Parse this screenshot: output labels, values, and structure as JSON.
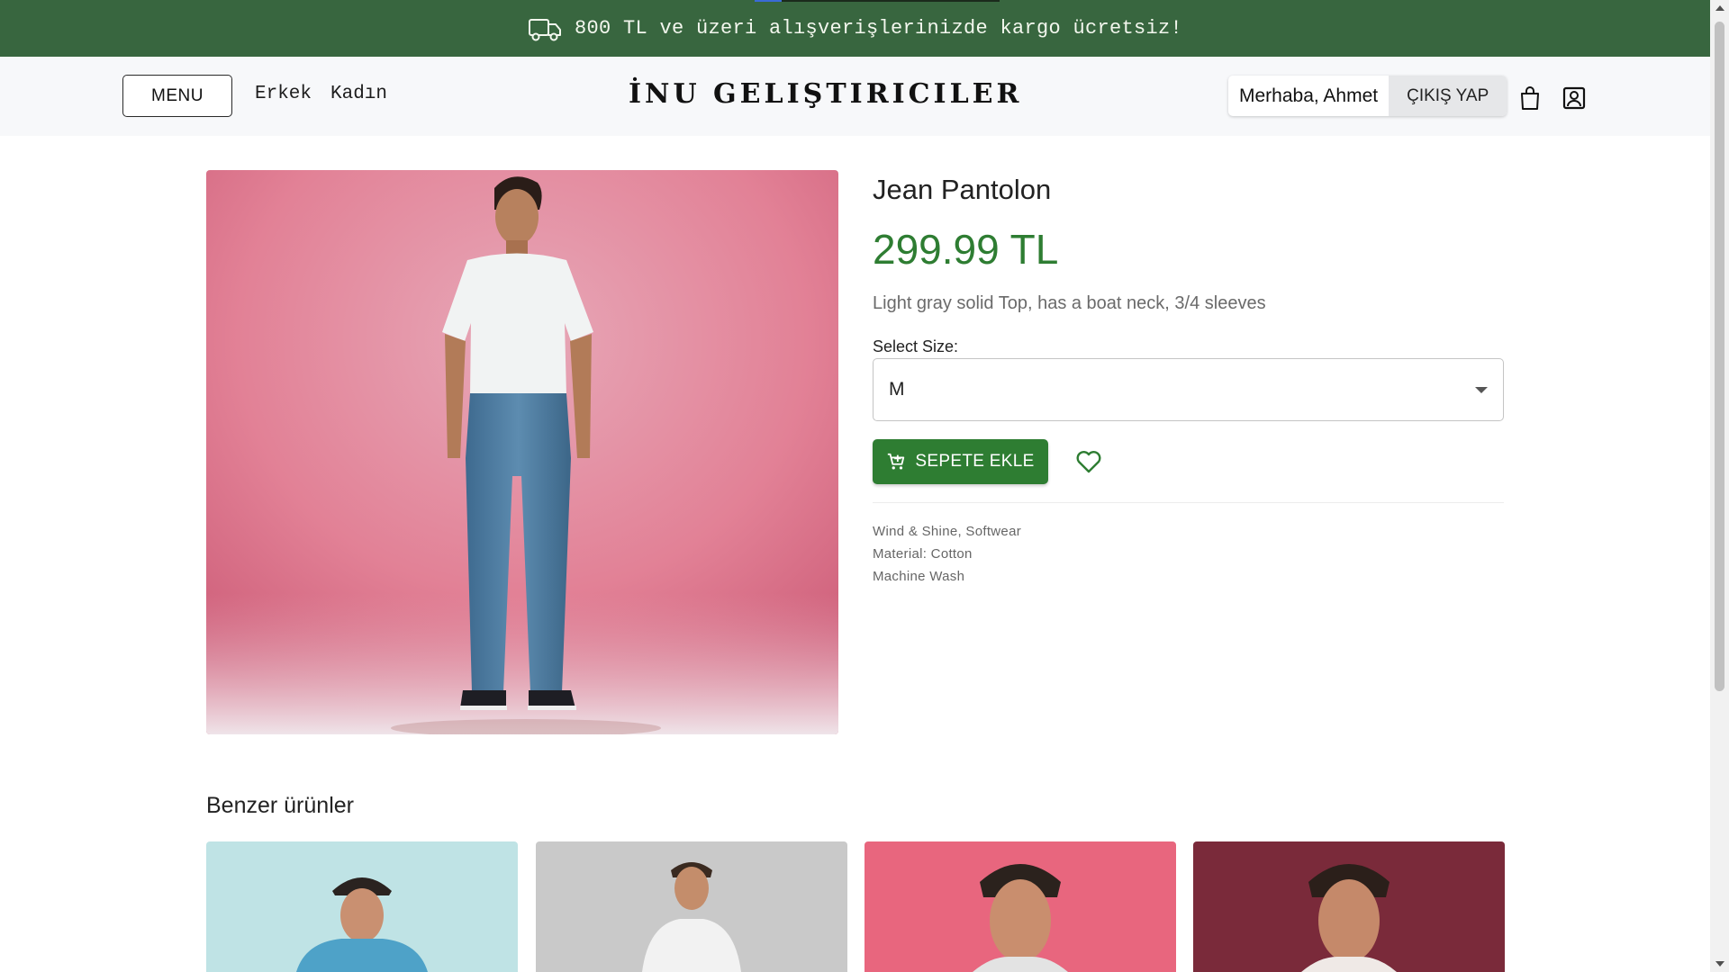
{
  "promo": {
    "text": "800 TL ve üzeri alışverişlerinizde kargo ücretsiz!",
    "icon": "truck-icon",
    "bg_color": "#38663f"
  },
  "header": {
    "menu_label": "MENU",
    "nav": [
      "Erkek",
      "Kadın"
    ],
    "brand": "İNU GELIŞTIRICILER",
    "greeting": "Merhaba, Ahmet",
    "logout_label": "ÇIKIŞ YAP",
    "icons": [
      "shopping-bag-icon",
      "user-profile-icon"
    ]
  },
  "product": {
    "title": "Jean Pantolon",
    "price": "299.99 TL",
    "description": "Light gray solid Top, has a boat neck, 3/4 sleeves",
    "size_label": "Select Size:",
    "selected_size": "M",
    "add_to_cart_label": "SEPETE EKLE",
    "meta": [
      "Wind & Shine, Softwear",
      "Material: Cotton",
      "Machine Wash"
    ],
    "price_color": "#2e7d32"
  },
  "similar": {
    "heading": "Benzer ürünler",
    "cards": [
      {
        "bg": "#bfe3e5"
      },
      {
        "bg": "#c9c9c9"
      },
      {
        "bg": "#e8667e"
      },
      {
        "bg": "#7a2a3a"
      }
    ]
  }
}
